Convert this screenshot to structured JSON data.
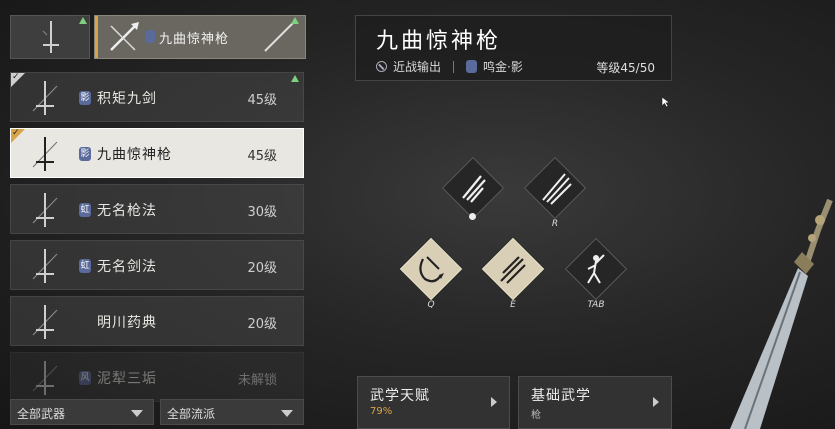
{
  "top_bar": {
    "selected_name": "九曲惊神枪"
  },
  "weapon_list": [
    {
      "name": "积矩九剑",
      "level": "45级",
      "badge": "影",
      "checked": true,
      "selected": false,
      "locked": false
    },
    {
      "name": "九曲惊神枪",
      "level": "45级",
      "badge": "影",
      "checked": true,
      "selected": true,
      "locked": false
    },
    {
      "name": "无名枪法",
      "level": "30级",
      "badge": "虹",
      "checked": false,
      "selected": false,
      "locked": false
    },
    {
      "name": "无名剑法",
      "level": "20级",
      "badge": "虹",
      "checked": false,
      "selected": false,
      "locked": false
    },
    {
      "name": "明川药典",
      "level": "20级",
      "badge": "",
      "checked": false,
      "selected": false,
      "locked": false
    },
    {
      "name": "泥犁三垢",
      "level": "未解锁",
      "badge": "风",
      "checked": false,
      "selected": false,
      "locked": true
    }
  ],
  "filters": {
    "weapon": "全部武器",
    "school": "全部流派"
  },
  "detail": {
    "title": "九曲惊神枪",
    "role": "近战输出",
    "school": "鸣金·影",
    "level": "等级45/50"
  },
  "skills": [
    {
      "key": "",
      "icon": "spear-thrust-icon",
      "style": "dark"
    },
    {
      "key": "R",
      "icon": "triple-spear-icon",
      "style": "dark"
    },
    {
      "key": "Q",
      "icon": "spin-slash-icon",
      "style": "light"
    },
    {
      "key": "E",
      "icon": "spear-strike-icon",
      "style": "light"
    },
    {
      "key": "TAB",
      "icon": "stance-figure-icon",
      "style": "dark"
    }
  ],
  "cards": {
    "talent_title": "武学天赋",
    "talent_progress": "79%",
    "basic_title": "基础武学",
    "basic_sub": "枪"
  },
  "colors": {
    "accent_gold": "#d8a44a",
    "progress_orange": "#d8a44a",
    "new_indicator": "#7fd07f"
  }
}
